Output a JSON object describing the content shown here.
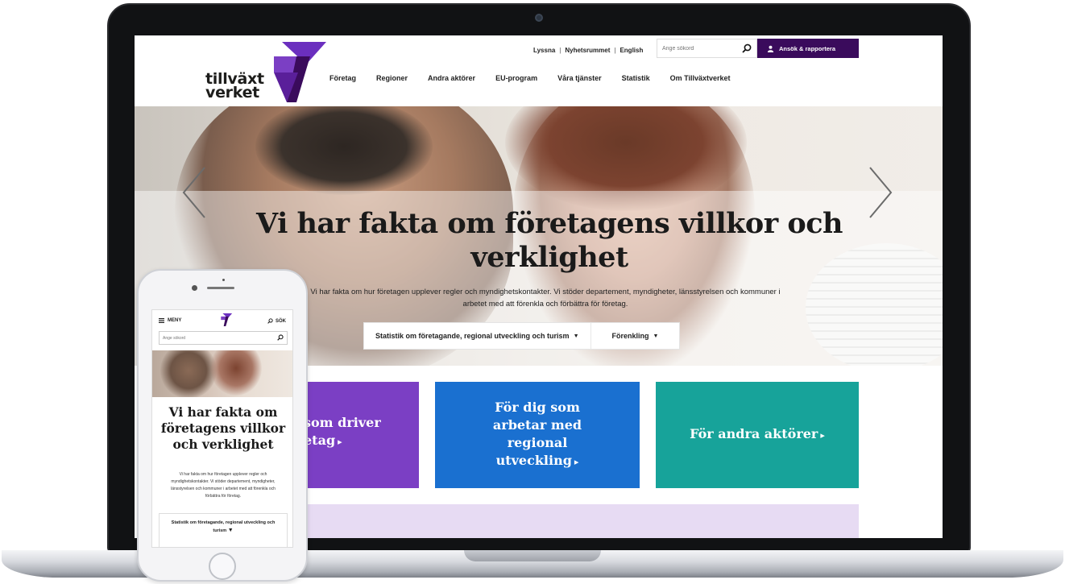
{
  "site": {
    "logo_line1": "tillväxt",
    "logo_line2": "verket",
    "utility_links": [
      "Lyssna",
      "Nyhetsrummet",
      "English"
    ],
    "search_placeholder": "Ange sökord",
    "report_button": "Ansök & rapportera",
    "nav": [
      "Företag",
      "Regioner",
      "Andra aktörer",
      "EU-program",
      "Våra tjänster",
      "Statistik",
      "Om Tillväxtverket"
    ]
  },
  "hero": {
    "title": "Vi har fakta om företagens villkor och verklighet",
    "lead": "Vi har fakta om hur företagen upplever regler och myndighetskontakter. Vi stöder departement, myndigheter, länsstyrelsen och kommuner i arbetet med att förenkla och förbättra för företag.",
    "link1": "Statistik om företagande, regional utveckling och turism",
    "link2": "Förenkling"
  },
  "tiles": {
    "tile1": "som driver etag",
    "tile2": "För dig som arbetar med regional utveckling",
    "tile3": "För andra aktörer"
  },
  "phone": {
    "menu_label": "MENY",
    "search_label": "SÖK",
    "search_placeholder": "Ange sökord",
    "title": "Vi har fakta om företagens villkor och verklighet",
    "lead": "Vi har fakta om hur företagen upplever regler och myndighetskontakter. Vi stöder departement, myndigheter, länsstyrelsen och kommuner i arbetet med att förenkla och förbättra för företag.",
    "cta": "Statistik om företagande, regional utveckling och turism"
  },
  "colors": {
    "brand_purple": "#3a0b5c",
    "tile_purple": "#7b3fc4",
    "tile_blue": "#1a70d0",
    "tile_teal": "#17a39a",
    "band_lavender": "#e7dbf3"
  }
}
